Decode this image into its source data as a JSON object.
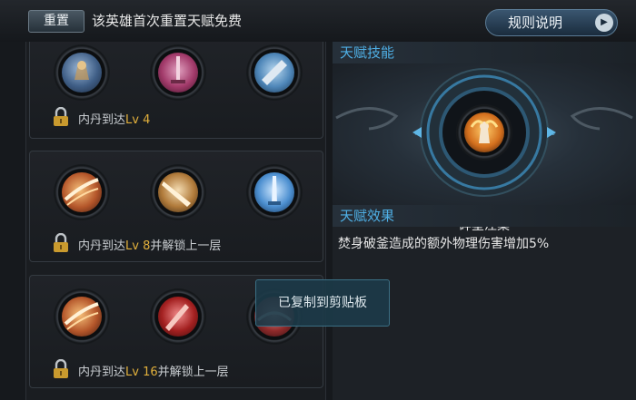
{
  "header": {
    "reset_label": "重置",
    "reset_note": "该英雄首次重置天赋免费",
    "rules_label": "规则说明",
    "rules_arrow": "▶"
  },
  "tiers": [
    {
      "lock_prefix": "内丹到达",
      "lock_level": "Lv 4",
      "lock_suffix": "",
      "skills": [
        "armored-warrior-icon",
        "crimson-blade-icon",
        "blue-cleaver-icon"
      ]
    },
    {
      "lock_prefix": "内丹到达",
      "lock_level": "Lv 8",
      "lock_suffix": "并解锁上一层",
      "skills": [
        "slash-strike-icon",
        "golden-sword-icon",
        "ice-blade-icon"
      ]
    },
    {
      "lock_prefix": "内丹到达",
      "lock_level": "Lv 16",
      "lock_suffix": "并解锁上一层",
      "skills": [
        "slash-strike-icon",
        "blood-claw-icon",
        "crimson-wave-icon"
      ]
    }
  ],
  "talent": {
    "section_title": "天赋技能",
    "skill_name": "碎星涅槃",
    "skill_icon": "flaming-warrior-icon",
    "effect_title": "天赋效果",
    "effect_text": "焚身破釜造成的额外物理伤害增加5%"
  },
  "toast": {
    "text": "已复制到剪贴板"
  },
  "colors": {
    "accent_blue": "#4fb0e6",
    "level_gold": "#e2b03c"
  }
}
